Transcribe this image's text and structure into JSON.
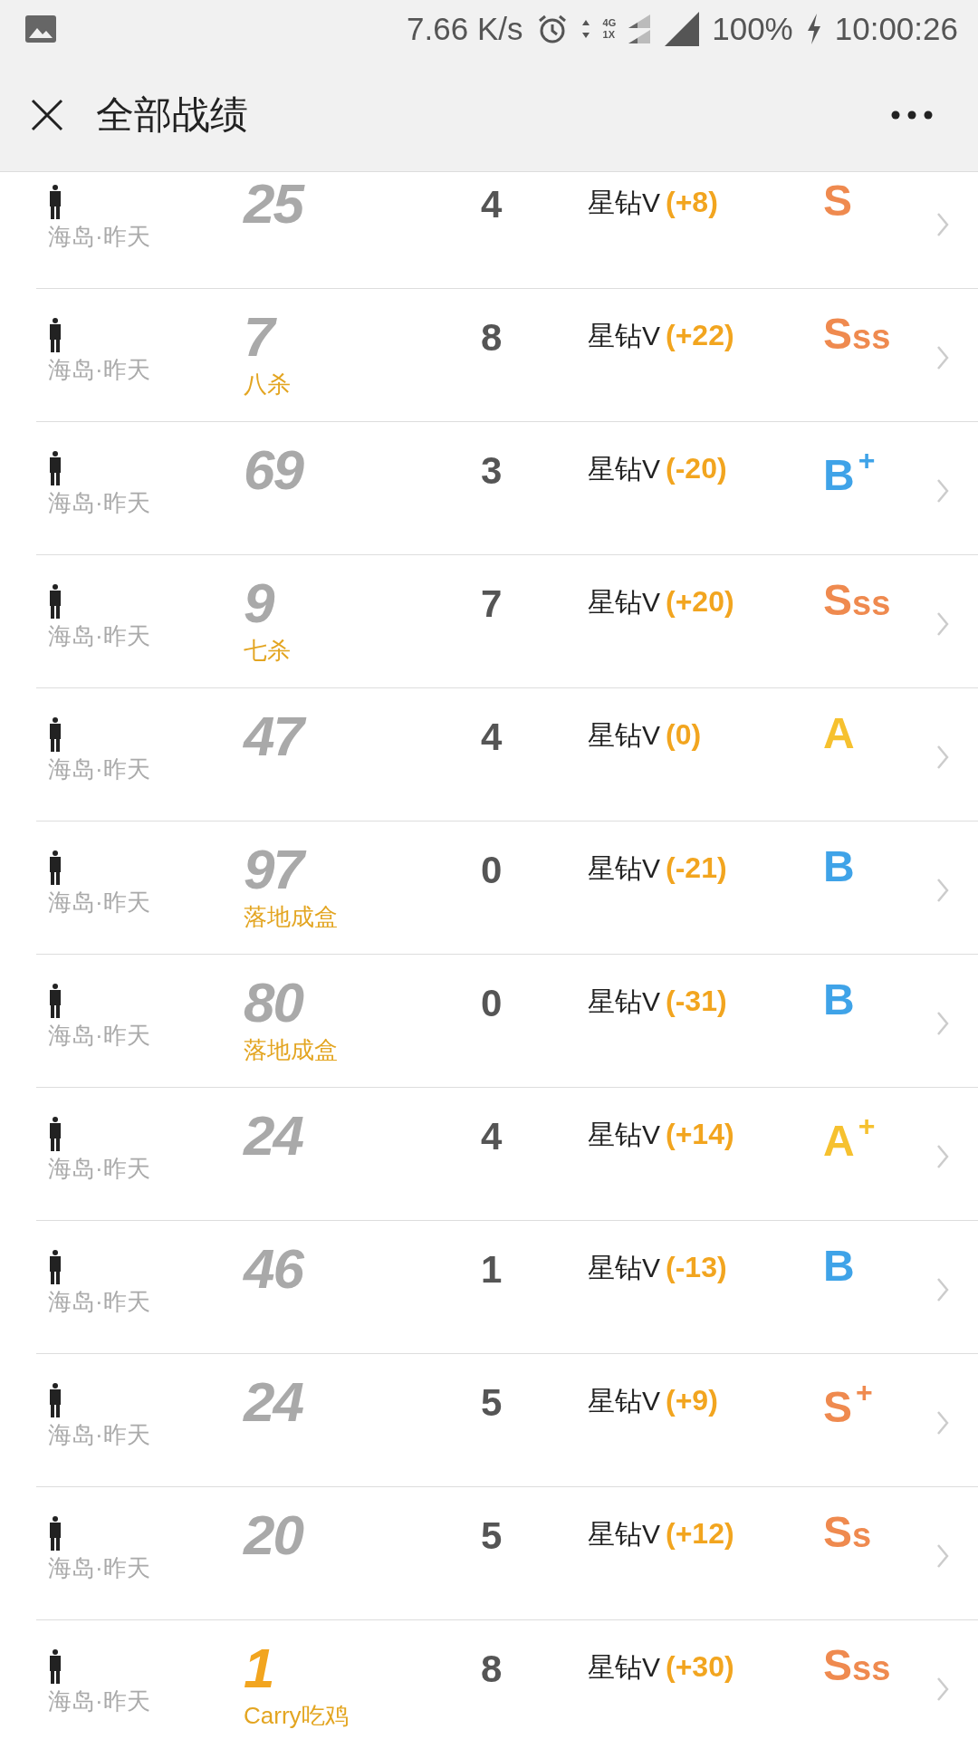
{
  "status_bar": {
    "speed": "7.66 K/s",
    "net_top": "4G",
    "net_bottom": "1X",
    "battery": "100%",
    "time": "10:00:26"
  },
  "header": {
    "title": "全部战绩"
  },
  "matches": [
    {
      "place": "海岛·昨天",
      "rank": "25",
      "winner": false,
      "kills": "4",
      "tier": "星钻V",
      "change": "(+8)",
      "grade": "S",
      "color": "#ef8a4f"
    },
    {
      "place": "海岛·昨天",
      "rank": "7",
      "winner": false,
      "note": "八杀",
      "kills": "8",
      "tier": "星钻V",
      "change": "(+22)",
      "grade": "S",
      "grade_suffix": "ss",
      "color": "#ef8a4f"
    },
    {
      "place": "海岛·昨天",
      "rank": "69",
      "winner": false,
      "kills": "3",
      "tier": "星钻V",
      "change": "(-20)",
      "grade": "B",
      "plus": "+",
      "color": "#3fa3e8"
    },
    {
      "place": "海岛·昨天",
      "rank": "9",
      "winner": false,
      "note": "七杀",
      "kills": "7",
      "tier": "星钻V",
      "change": "(+20)",
      "grade": "S",
      "grade_suffix": "ss",
      "color": "#ef8a4f"
    },
    {
      "place": "海岛·昨天",
      "rank": "47",
      "winner": false,
      "kills": "4",
      "tier": "星钻V",
      "change": "(0)",
      "grade": "A",
      "color": "#f6c12f"
    },
    {
      "place": "海岛·昨天",
      "rank": "97",
      "winner": false,
      "note": "落地成盒",
      "kills": "0",
      "tier": "星钻V",
      "change": "(-21)",
      "grade": "B",
      "color": "#3fa3e8"
    },
    {
      "place": "海岛·昨天",
      "rank": "80",
      "winner": false,
      "note": "落地成盒",
      "kills": "0",
      "tier": "星钻V",
      "change": "(-31)",
      "grade": "B",
      "color": "#3fa3e8"
    },
    {
      "place": "海岛·昨天",
      "rank": "24",
      "winner": false,
      "kills": "4",
      "tier": "星钻V",
      "change": "(+14)",
      "grade": "A",
      "plus": "+",
      "color": "#f6c12f"
    },
    {
      "place": "海岛·昨天",
      "rank": "46",
      "winner": false,
      "kills": "1",
      "tier": "星钻V",
      "change": "(-13)",
      "grade": "B",
      "color": "#3fa3e8"
    },
    {
      "place": "海岛·昨天",
      "rank": "24",
      "winner": false,
      "kills": "5",
      "tier": "星钻V",
      "change": "(+9)",
      "grade": "S",
      "plus": "+",
      "color": "#ef8a4f"
    },
    {
      "place": "海岛·昨天",
      "rank": "20",
      "winner": false,
      "kills": "5",
      "tier": "星钻V",
      "change": "(+12)",
      "grade": "S",
      "grade_suffix": "s",
      "color": "#ef8a4f"
    },
    {
      "place": "海岛·昨天",
      "rank": "1",
      "winner": true,
      "note": "Carry吃鸡",
      "kills": "8",
      "tier": "星钻V",
      "change": "(+30)",
      "grade": "S",
      "grade_suffix": "ss",
      "color": "#ef8a4f"
    }
  ]
}
